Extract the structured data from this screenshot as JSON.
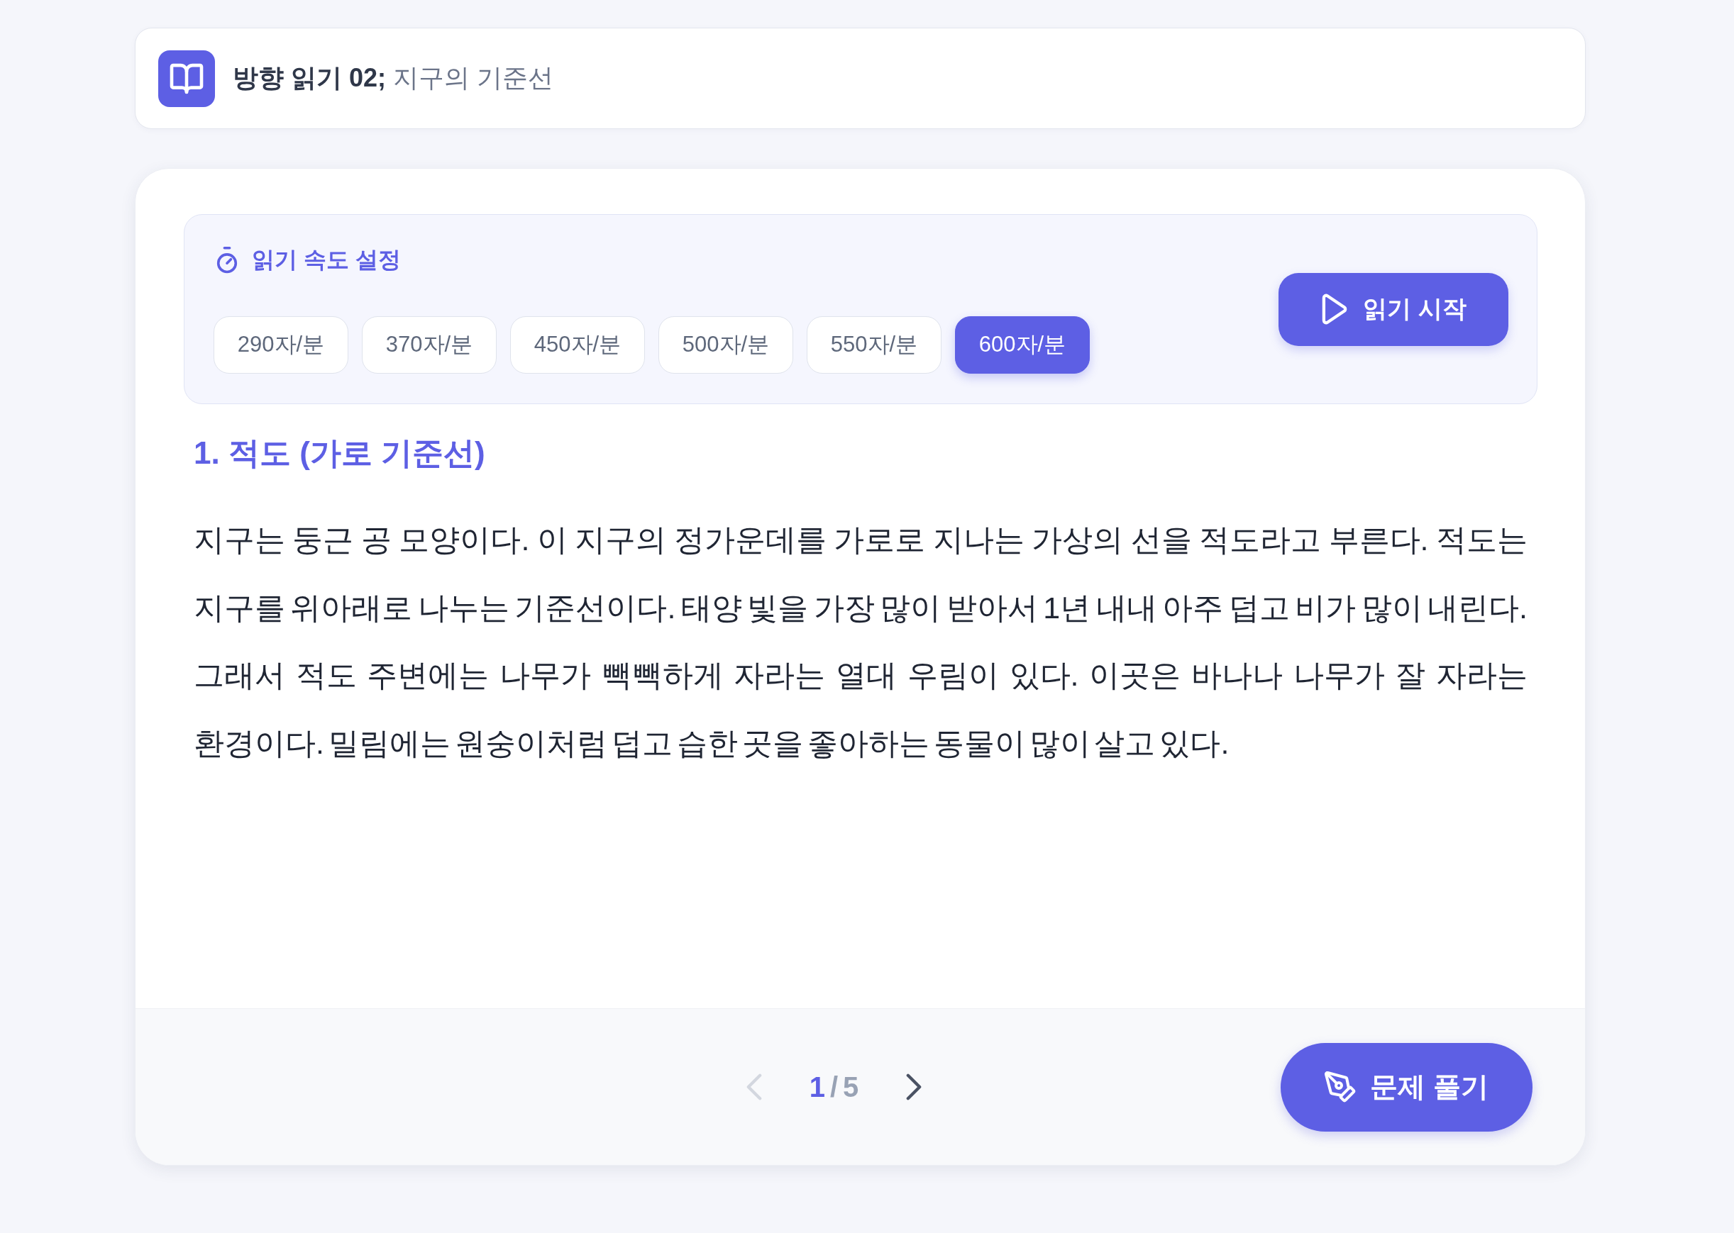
{
  "header": {
    "title": "**방향 읽기 02;** 지구의 기준선"
  },
  "speed_settings": {
    "title": "읽기 속도 설정",
    "options": [
      {
        "label": "290자/분",
        "selected": false
      },
      {
        "label": "370자/분",
        "selected": false
      },
      {
        "label": "450자/분",
        "selected": false
      },
      {
        "label": "500자/분",
        "selected": false
      },
      {
        "label": "550자/분",
        "selected": false
      },
      {
        "label": "600자/분",
        "selected": true
      }
    ],
    "start_button": "읽기 시작"
  },
  "section": {
    "heading": "1. 적도 (가로 기준선)",
    "paragraph": "지구는 둥근 공 모양이다. 이 지구의 정가운데를 가로로 지나는 가상의 선을 적도라고 부른다. 적도는 지구를 위아래로 나누는 기준선이다. 태양 빛을 가장 많이 받아서 1년 내내 아주 덥고 비가 많이 내린다. 그래서 적도 주변에는 나무가 빽빽하게 자라는 열대 우림이 있다. 이곳은 바나나 나무가 잘 자라는 환경이다. 밀림에는 원숭이처럼 덥고 습한 곳을 좋아하는 동물이 많이 살고 있다."
  },
  "footer": {
    "pagination": {
      "previous": {
        "disabled": true
      },
      "current": "1",
      "separator": "/",
      "total": "5",
      "next": {
        "disabled": false
      }
    },
    "solve_button": "문제 풀기"
  }
}
